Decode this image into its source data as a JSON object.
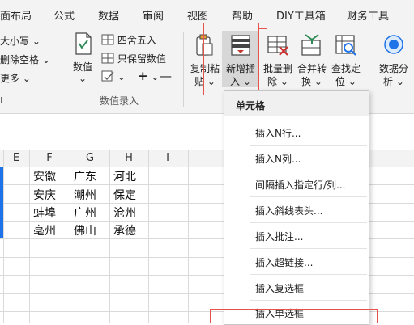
{
  "tabs": [
    "面布局",
    "公式",
    "数据",
    "审阅",
    "视图",
    "帮助",
    "DIY工具箱",
    "财务工具"
  ],
  "ribbon": {
    "left_items": [
      "大小写",
      "删除空格",
      "更多"
    ],
    "numeric": {
      "label_top": "数值",
      "label_bottom": "⌄"
    },
    "round_label": "四舍五入",
    "keep_label": "只保留数值",
    "plus_symbol": "+",
    "group_numeric_entry": "数值录入",
    "copy_paste": {
      "line1": "复制粘",
      "line2": "贴"
    },
    "insert_new": {
      "line1": "新增插",
      "line2": "入"
    },
    "batch_delete": {
      "line1": "批量删",
      "line2": "除"
    },
    "merge_convert": {
      "line1": "合并转",
      "line2": "换"
    },
    "find_locate": {
      "line1": "查找定",
      "line2": "位"
    },
    "data_analysis": {
      "line1": "数据分",
      "line2": "析"
    }
  },
  "columns": [
    "E",
    "F",
    "G",
    "H",
    "I"
  ],
  "rows": [
    [
      "安徽",
      "广东",
      "河北"
    ],
    [
      "安庆",
      "潮州",
      "保定"
    ],
    [
      "蚌埠",
      "广州",
      "沧州"
    ],
    [
      "亳州",
      "佛山",
      "承德"
    ]
  ],
  "menu": {
    "header": "单元格",
    "items": [
      "插入N行...",
      "插入N列...",
      "间隔插入指定行/列...",
      "插入斜线表头...",
      "插入批注...",
      "插入超链接...",
      "插入复选框",
      "插入单选框"
    ]
  },
  "colors": {
    "highlight_box": "#e5534b",
    "selection": "#1e73e8"
  }
}
